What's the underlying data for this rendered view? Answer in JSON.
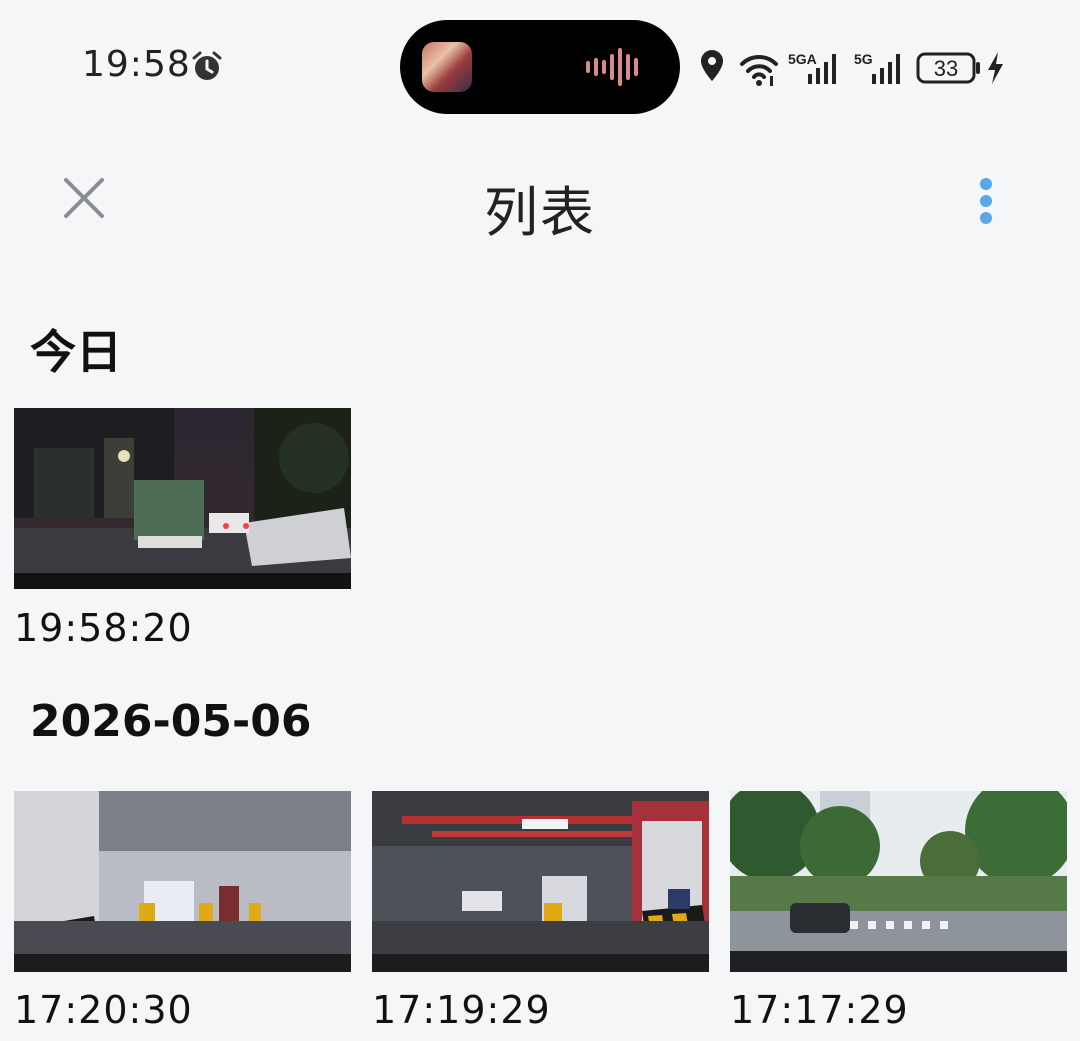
{
  "status_bar": {
    "time": "19:58",
    "wifi_label": "5GA",
    "cell_label": "5G",
    "battery": "33"
  },
  "header": {
    "title": "列表"
  },
  "sections": [
    {
      "title": "今日",
      "items": [
        {
          "time": "19:58:20"
        }
      ]
    },
    {
      "title": "2026-05-06",
      "items": [
        {
          "time": "17:20:30"
        },
        {
          "time": "17:19:29"
        },
        {
          "time": "17:17:29"
        }
      ]
    }
  ],
  "colors": {
    "background": "#f5f6f8",
    "accent": "#4a9de0",
    "close_icon": "#8a8d92"
  }
}
